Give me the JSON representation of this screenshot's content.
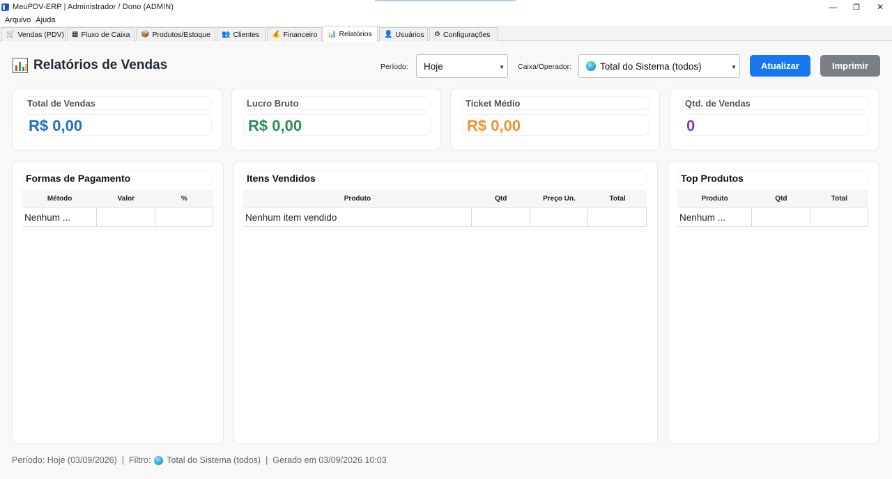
{
  "window": {
    "title": "MeuPDV-ERP  |  Administrador / Dono (ADMIN)",
    "minimize": "—",
    "restore": "❐",
    "close": "✕"
  },
  "menu": {
    "items": [
      "Arquivo",
      "Ajuda"
    ]
  },
  "tabs": [
    {
      "label": "Vendas (PDV)",
      "icon": "cart-icon",
      "glyph": "🛒"
    },
    {
      "label": "Fluxo de Caixa",
      "icon": "cashbox-icon",
      "glyph": "▦"
    },
    {
      "label": "Produtos/Estoque",
      "icon": "box-icon",
      "glyph": "📦"
    },
    {
      "label": "Clientes",
      "icon": "people-icon",
      "glyph": "👥"
    },
    {
      "label": "Financeiro",
      "icon": "moneybag-icon",
      "glyph": "💰"
    },
    {
      "label": "Relatórios",
      "icon": "chart-icon",
      "glyph": "📊"
    },
    {
      "label": "Usuários",
      "icon": "user-icon",
      "glyph": "👤"
    },
    {
      "label": "Configurações",
      "icon": "gear-icon",
      "glyph": "⚙"
    }
  ],
  "active_tab": "Relatórios",
  "header": {
    "title": "Relatórios de Vendas",
    "periodo_label": "Período:",
    "periodo_value": "Hoje",
    "caixa_label": "Caixa/Operador:",
    "caixa_value": "Total do Sistema (todos)",
    "atualizar_label": "Atualizar",
    "imprimir_label": "Imprimir"
  },
  "kpis": [
    {
      "label": "Total de Vendas",
      "value": "R$ 0,00",
      "color": "#1f6fcf"
    },
    {
      "label": "Lucro Bruto",
      "value": "R$ 0,00",
      "color": "#2e8b57"
    },
    {
      "label": "Ticket Médio",
      "value": "R$ 0,00",
      "color": "#f0922e"
    },
    {
      "label": "Qtd. de Vendas",
      "value": "0",
      "color": "#7a44b8"
    }
  ],
  "panels": {
    "pagamento": {
      "title": "Formas de Pagamento",
      "columns": [
        "Método",
        "Valor",
        "%"
      ],
      "rows": [
        [
          "Nenhum ...",
          "",
          ""
        ]
      ]
    },
    "itens": {
      "title": "Itens Vendidos",
      "columns": [
        "Produto",
        "Qtd",
        "Preço Un.",
        "Total"
      ],
      "rows": [
        [
          "Nenhum item vendido",
          "",
          "",
          ""
        ]
      ]
    },
    "top": {
      "title": "Top Produtos",
      "columns": [
        "Produto",
        "Qtd",
        "Total"
      ],
      "rows": [
        [
          "Nenhum ...",
          "",
          ""
        ]
      ]
    }
  },
  "footer": {
    "periodo": "Período: Hoje (03/09/2026)",
    "sep1": "|",
    "filtro_label": "Filtro:",
    "filtro_value": "Total do Sistema (todos)",
    "sep2": "|",
    "gerado": "Gerado em 03/09/2026 10:03"
  }
}
